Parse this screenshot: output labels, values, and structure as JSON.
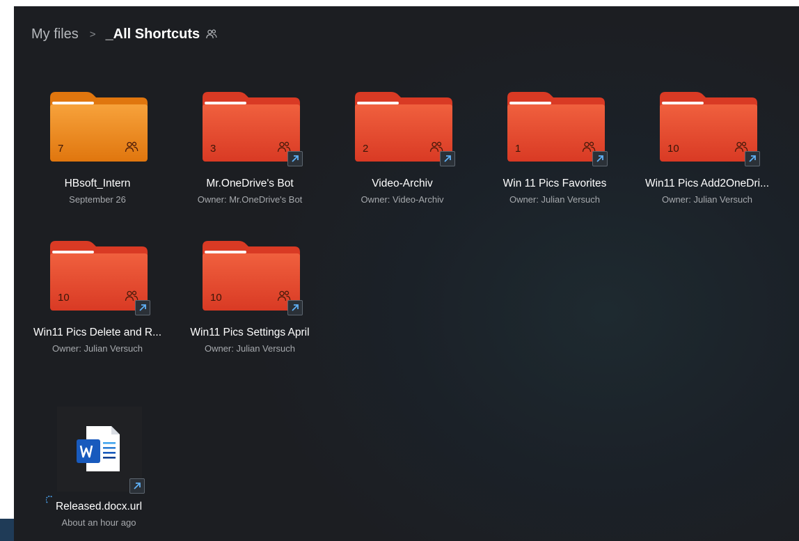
{
  "breadcrumb": {
    "root": "My files",
    "separator": ">",
    "current": "_All Shortcuts",
    "shared_icon": "people-icon"
  },
  "folders": [
    {
      "name": "HBsoft_Intern",
      "meta": "September 26",
      "count": "7",
      "shared": true,
      "shortcut": false,
      "color": "#f08a1e"
    },
    {
      "name": "Mr.OneDrive's Bot",
      "meta": "Owner: Mr.OneDrive's Bot",
      "count": "3",
      "shared": true,
      "shortcut": true,
      "color": "#e8492b"
    },
    {
      "name": "Video-Archiv",
      "meta": "Owner: Video-Archiv",
      "count": "2",
      "shared": true,
      "shortcut": true,
      "color": "#e8492b"
    },
    {
      "name": "Win 11 Pics Favorites",
      "meta": "Owner: Julian Versuch",
      "count": "1",
      "shared": true,
      "shortcut": true,
      "color": "#e8492b"
    },
    {
      "name": "Win11 Pics Add2OneDri...",
      "meta": "Owner: Julian Versuch",
      "count": "10",
      "shared": true,
      "shortcut": true,
      "color": "#e8492b"
    },
    {
      "name": "Win11 Pics Delete and R...",
      "meta": "Owner: Julian Versuch",
      "count": "10",
      "shared": true,
      "shortcut": true,
      "color": "#e8492b"
    },
    {
      "name": "Win11 Pics Settings April",
      "meta": "Owner: Julian Versuch",
      "count": "10",
      "shared": true,
      "shortcut": true,
      "color": "#e8492b"
    }
  ],
  "file": {
    "name": "Released.docx.url",
    "meta": "About an hour ago",
    "icon": "word-document-icon",
    "shortcut": true,
    "status_icon": "sync-icon"
  },
  "colors": {
    "background": "#1c2026",
    "orange_folder": "#f08a1e",
    "red_folder": "#e8492b",
    "word_blue": "#185abd"
  }
}
